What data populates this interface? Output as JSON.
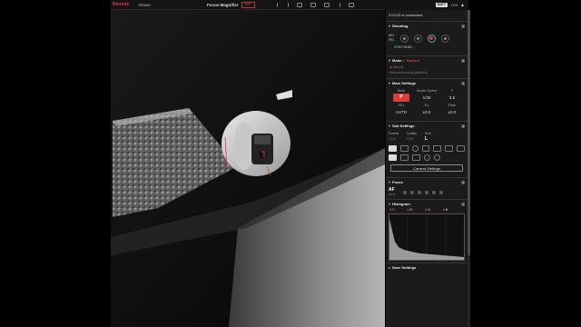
{
  "app": {
    "name": "Remote",
    "viewer_tab": "Viewer"
  },
  "topbar": {
    "focus_magnifier": "Focus Magnifier",
    "focus_magnifier_state": "OFF"
  },
  "status": {
    "battery_label": "BATT",
    "battery_pct": "71%"
  },
  "panel": {
    "connection": "ZV-E10 is connected.",
    "shooting": {
      "title": "Shooting",
      "ael": "AEL",
      "fel": "FEL",
      "stby": "STBY",
      "timecode": "00:00:..."
    },
    "mode": {
      "title": "Mode :",
      "value": "Normal",
      "sub_label": "Normal",
      "sub_text": "Interval shooting (disabled)"
    },
    "main_settings": {
      "title": "Main Settings",
      "headers": [
        "Mode",
        "Shutter Speed",
        "F"
      ],
      "mode_value": "P",
      "shutter": "1/30",
      "fnum": "3.5",
      "headers2": [
        "ISO",
        "EV",
        "Flash"
      ],
      "iso": "AUTO",
      "ev": "±0.0",
      "flash": "±0.0"
    },
    "sub_settings": {
      "title": "Sub Settings",
      "headers": [
        "Format",
        "Quality",
        "Size"
      ],
      "format": "RAW",
      "quality": "FINE",
      "size": "L",
      "camera_settings_button": "Camera Settings"
    },
    "focus": {
      "title": "Focus",
      "af_label": "AF",
      "af_sub": "AF-S"
    },
    "histogram": {
      "title": "Histogram",
      "channels": [
        "Y",
        "R",
        "G",
        "B"
      ]
    },
    "more": {
      "title": "Save Settings"
    }
  }
}
